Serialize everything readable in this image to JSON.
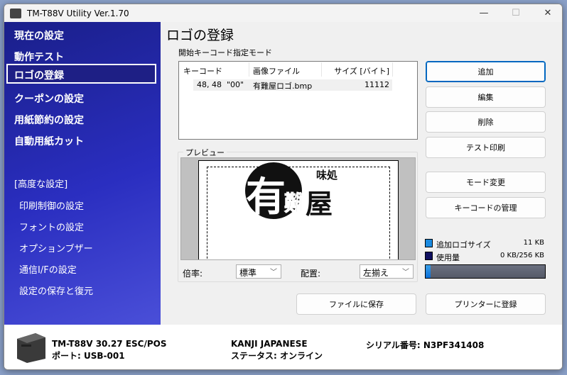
{
  "window": {
    "title": "TM-T88V Utility Ver.1.70",
    "minimize": "—",
    "maximize": "☐",
    "close": "✕"
  },
  "sidebar": {
    "items": [
      {
        "label": "現在の設定"
      },
      {
        "label": "動作テスト"
      },
      {
        "label": "ロゴの登録",
        "selected": true
      },
      {
        "label": "クーポンの設定"
      },
      {
        "label": "用紙節約の設定"
      },
      {
        "label": "自動用紙カット"
      }
    ],
    "advanced_header": "[高度な設定]",
    "advanced_items": [
      {
        "label": "印刷制御の設定"
      },
      {
        "label": "フォントの設定"
      },
      {
        "label": "オプションブザー"
      },
      {
        "label": "通信I/Fの設定"
      },
      {
        "label": "設定の保存と復元"
      }
    ]
  },
  "main": {
    "title": "ロゴの登録",
    "mode_label": "開始キーコード指定モード",
    "list": {
      "columns": [
        "キーコード",
        "画像ファイル",
        "サイズ [バイト]"
      ],
      "rows": [
        {
          "key": "48, 48  \"00\"",
          "file": "有難屋ロゴ.bmp",
          "size": "11112"
        }
      ]
    },
    "preview": {
      "label": "プレビュー",
      "logo_text": [
        "有",
        "難",
        "屋",
        "味処"
      ],
      "zoom_label": "倍率:",
      "zoom_value": "標準",
      "align_label": "配置:",
      "align_value": "左揃え"
    },
    "buttons": {
      "add": "追加",
      "edit": "編集",
      "delete": "削除",
      "test_print": "テスト印刷",
      "mode_change": "モード変更",
      "keycode_manage": "キーコードの管理",
      "save_file": "ファイルに保存",
      "register": "プリンターに登録"
    },
    "capacity": {
      "added_label": "追加ロゴサイズ",
      "added_value": "11 KB",
      "used_label": "使用量",
      "used_value": "0 KB/256 KB",
      "fill_percent": 4.3,
      "added_color": "#1a8ae0",
      "used_color": "#101060"
    }
  },
  "footer": {
    "model": "TM-T88V 30.27 ESC/POS",
    "port": "ポート: USB-001",
    "font": "KANJI JAPANESE",
    "status": "ステータス: オンライン",
    "serial": "シリアル番号: N3PF341408"
  }
}
